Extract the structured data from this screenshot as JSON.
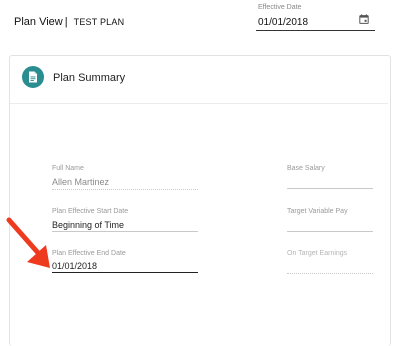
{
  "header": {
    "page_title": "Plan View",
    "separator": "|",
    "plan_name": "TEST PLAN",
    "effective_date": {
      "label": "Effective Date",
      "value": "01/01/2018",
      "icon": "calendar-icon"
    }
  },
  "card": {
    "title": "Plan Summary",
    "icon": "document-icon",
    "accent_color": "#2a8e90",
    "fields": {
      "full_name": {
        "label": "Full Name",
        "value": "Allen Martinez"
      },
      "start_date": {
        "label": "Plan Effective Start Date",
        "value": "Beginning of Time"
      },
      "end_date": {
        "label": "Plan Effective End Date",
        "value": "01/01/2018"
      },
      "base_salary": {
        "label": "Base Salary",
        "value": ""
      },
      "target_variable_pay": {
        "label": "Target Variable Pay",
        "value": ""
      },
      "on_target_earnings": {
        "label": "On Target Earnings",
        "value": ""
      }
    }
  },
  "annotation": {
    "arrow_color": "#ee3b1f"
  }
}
